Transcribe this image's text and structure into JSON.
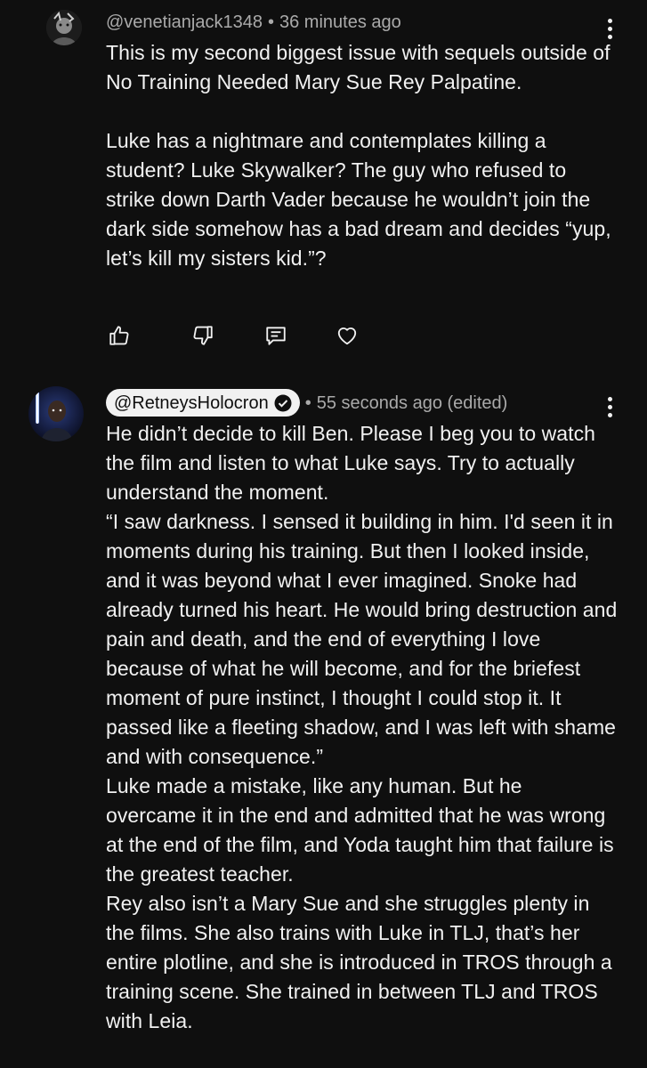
{
  "comments": [
    {
      "handle": "@venetianjack1348",
      "separator": "•",
      "time": "36 minutes ago",
      "paragraphs": [
        "This is my second biggest issue with sequels outside of No Training Needed Mary Sue Rey Palpatine.",
        "Luke has a nightmare and contemplates killing a student? Luke Skywalker? The guy who refused to strike down Darth Vader because he wouldn’t join the dark side somehow has a bad dream and decides “yup, let’s kill my sisters kid.”?"
      ],
      "actions": [
        "thumb-up-icon",
        "thumb-down-icon",
        "reply-icon",
        "heart-icon"
      ]
    },
    {
      "handle": "@RetneysHolocron",
      "verified": true,
      "separator": "•",
      "time": "55 seconds ago (edited)",
      "paragraphs": [
        "He didn’t decide to kill Ben. Please I beg you to watch the film and listen to what Luke says. Try to actually understand the moment.",
        "“I saw darkness. I sensed it building in him. I'd seen it in moments during his training. But then I looked inside, and it was beyond what I ever imagined. Snoke had already turned his heart. He would bring destruction and pain and death, and the end of everything I love because of what he will become, and for the briefest moment of pure instinct, I thought I could stop it. It passed like a fleeting shadow, and I was left with shame and with consequence.”",
        "Luke made a mistake, like any human. But he overcame it in the end and admitted that he was wrong at the end of the film, and Yoda taught him that failure is the greatest teacher.",
        "Rey also isn’t a Mary Sue and she struggles plenty in the films. She also trains with Luke in TLJ, that’s her entire plotline, and she is introduced in TROS through a training scene. She trained in between TLJ and TROS with Leia."
      ]
    }
  ],
  "colors": {
    "background": "#0f0f0f",
    "text": "#f1f1f1",
    "secondary": "#aaaaaa",
    "pill": "#f1f1f1"
  }
}
